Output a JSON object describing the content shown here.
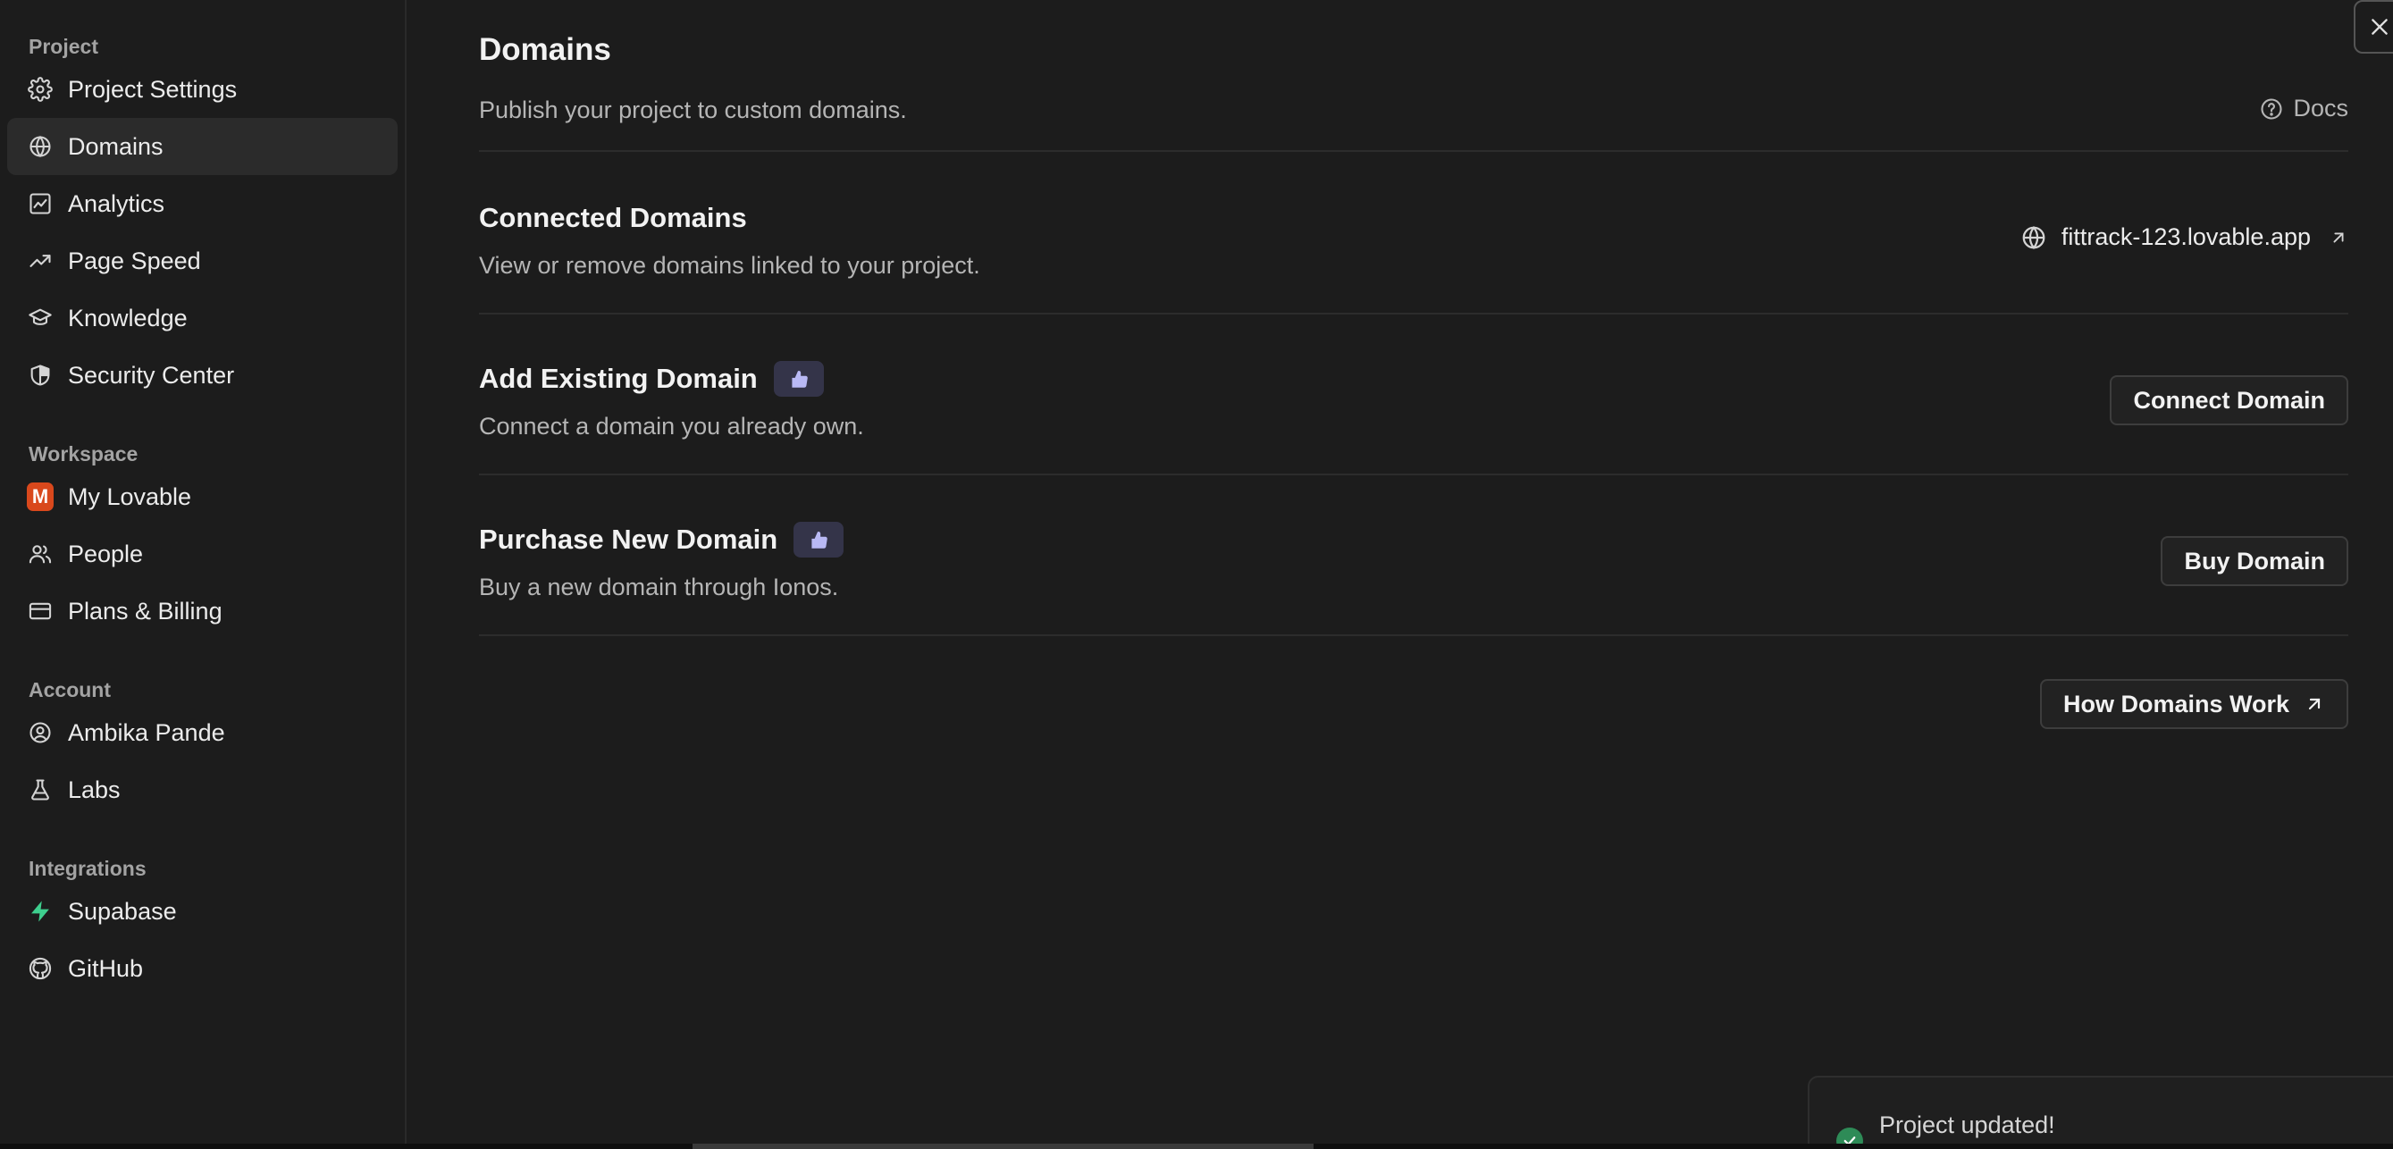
{
  "sidebar": {
    "sections": [
      {
        "label": "Project",
        "items": [
          {
            "label": "Project Settings",
            "icon": "gear-icon"
          },
          {
            "label": "Domains",
            "icon": "globe-icon",
            "active": true
          },
          {
            "label": "Analytics",
            "icon": "chart-icon"
          },
          {
            "label": "Page Speed",
            "icon": "trend-up-icon"
          },
          {
            "label": "Knowledge",
            "icon": "graduation-cap-icon"
          },
          {
            "label": "Security Center",
            "icon": "shield-icon"
          }
        ]
      },
      {
        "label": "Workspace",
        "items": [
          {
            "label": "My Lovable",
            "icon": "workspace-avatar",
            "avatar_letter": "M"
          },
          {
            "label": "People",
            "icon": "people-icon"
          },
          {
            "label": "Plans & Billing",
            "icon": "credit-card-icon"
          }
        ]
      },
      {
        "label": "Account",
        "items": [
          {
            "label": "Ambika Pande",
            "icon": "user-circle-icon"
          },
          {
            "label": "Labs",
            "icon": "flask-icon"
          }
        ]
      },
      {
        "label": "Integrations",
        "items": [
          {
            "label": "Supabase",
            "icon": "supabase-icon"
          },
          {
            "label": "GitHub",
            "icon": "github-icon"
          }
        ]
      }
    ]
  },
  "main": {
    "title": "Domains",
    "subtitle": "Publish your project to custom domains.",
    "docs_label": "Docs",
    "connected": {
      "title": "Connected Domains",
      "subtitle": "View or remove domains linked to your project.",
      "domain": "fittrack-123.lovable.app"
    },
    "add_existing": {
      "title": "Add Existing Domain",
      "subtitle": "Connect a domain you already own.",
      "button": "Connect Domain"
    },
    "purchase": {
      "title": "Purchase New Domain",
      "subtitle": "Buy a new domain through Ionos.",
      "button": "Buy Domain"
    },
    "how_button": "How Domains Work"
  },
  "toast": {
    "message": "Project updated!"
  },
  "colors": {
    "background": "#1c1c1c",
    "active_nav": "#2b2b2b",
    "badge": "#343449",
    "badge_icon": "#b9b9f5",
    "avatar": "#d9481c",
    "supabase": "#3ecf8e",
    "success": "#2e8b57"
  }
}
